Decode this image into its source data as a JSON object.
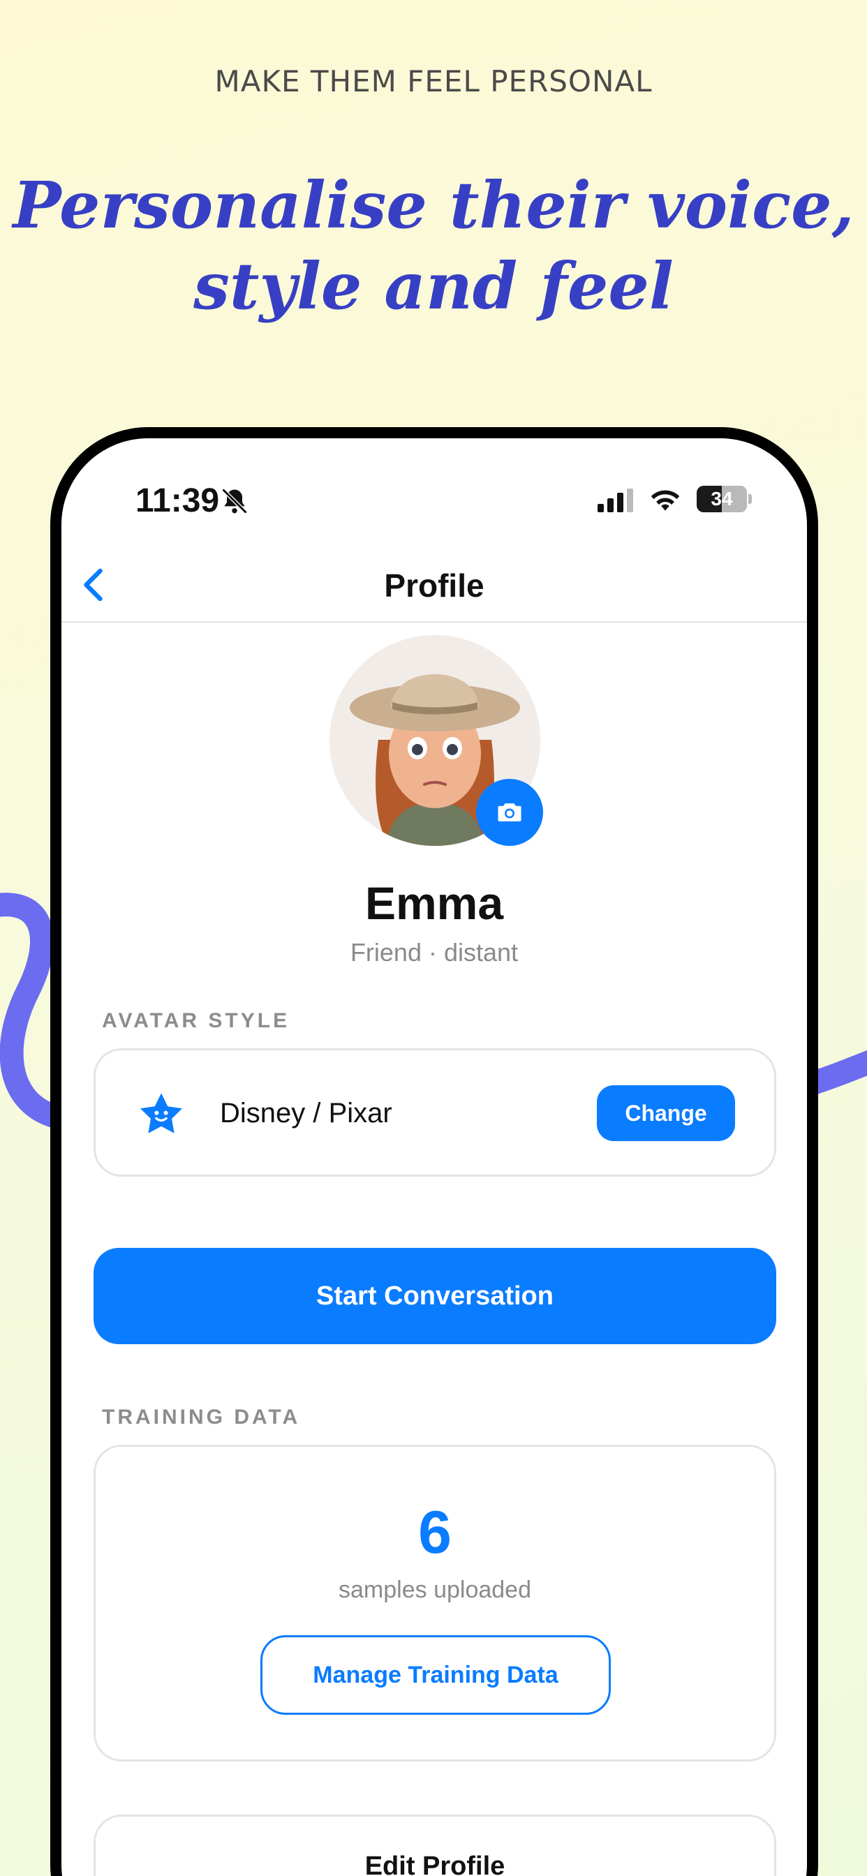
{
  "marketing": {
    "eyebrow": "MAKE THEM FEEL PERSONAL",
    "headline_line1": "Personalise their voice,",
    "headline_line2": "style and feel",
    "accent_color": "#3740c4",
    "squiggle_color": "#6b6cf0"
  },
  "status_bar": {
    "time": "11:39",
    "battery": "34",
    "icons": [
      "bell-slash-icon",
      "signal-icon",
      "wifi-icon",
      "battery-icon"
    ]
  },
  "nav": {
    "title": "Profile",
    "back_icon": "chevron-left-icon"
  },
  "profile": {
    "name": "Emma",
    "relation": "Friend · distant",
    "camera_icon": "camera-icon"
  },
  "avatar_style": {
    "section_label": "AVATAR STYLE",
    "style_name": "Disney / Pixar",
    "icon": "star-face-icon",
    "change_label": "Change"
  },
  "actions": {
    "start_label": "Start Conversation"
  },
  "training": {
    "section_label": "TRAINING DATA",
    "count": "6",
    "count_label": "samples uploaded",
    "manage_label": "Manage Training Data"
  },
  "edit": {
    "label": "Edit Profile"
  },
  "colors": {
    "primary": "#0a7cff",
    "background": "#fdf9d6"
  }
}
